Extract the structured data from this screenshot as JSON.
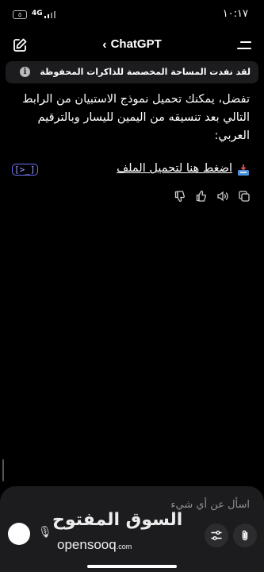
{
  "status_bar": {
    "time": "١٠:١٧",
    "network": "4G",
    "battery": "٥"
  },
  "nav": {
    "title": "ChatGPT",
    "back_glyph": "‹"
  },
  "banner": {
    "text": "لقد نفدت المساحة المخصصة للذاكرات المحفوظة",
    "icon": "info-icon"
  },
  "message": {
    "text": "تفضل، يمكنك تحميل نموذج الاستبيان من الرابط التالي بعد تنسيقه من اليمين لليسار وبالترقيم العربي:",
    "link_text": "اضغط هنا لتحميل الملف",
    "link_icon": "download-tray-icon",
    "code_badge": "[>_]"
  },
  "actions": [
    "copy-icon",
    "speaker-icon",
    "thumbs-up-icon",
    "thumbs-down-icon"
  ],
  "composer": {
    "placeholder": "اسأل عن أي شيء",
    "attach_icon": "paperclip-icon",
    "tools_icon": "sliders-icon",
    "mic_icon": "mic-icon"
  },
  "watermark": {
    "arabic": "السوق المفتوح",
    "latin": "opensooq",
    "suffix": ".com"
  },
  "colors": {
    "background": "#000000",
    "banner_bg": "#1c1c1e",
    "composer_bg": "#1c1c1e",
    "placeholder": "#8e8e93",
    "code_badge": "#6e6ef5"
  }
}
